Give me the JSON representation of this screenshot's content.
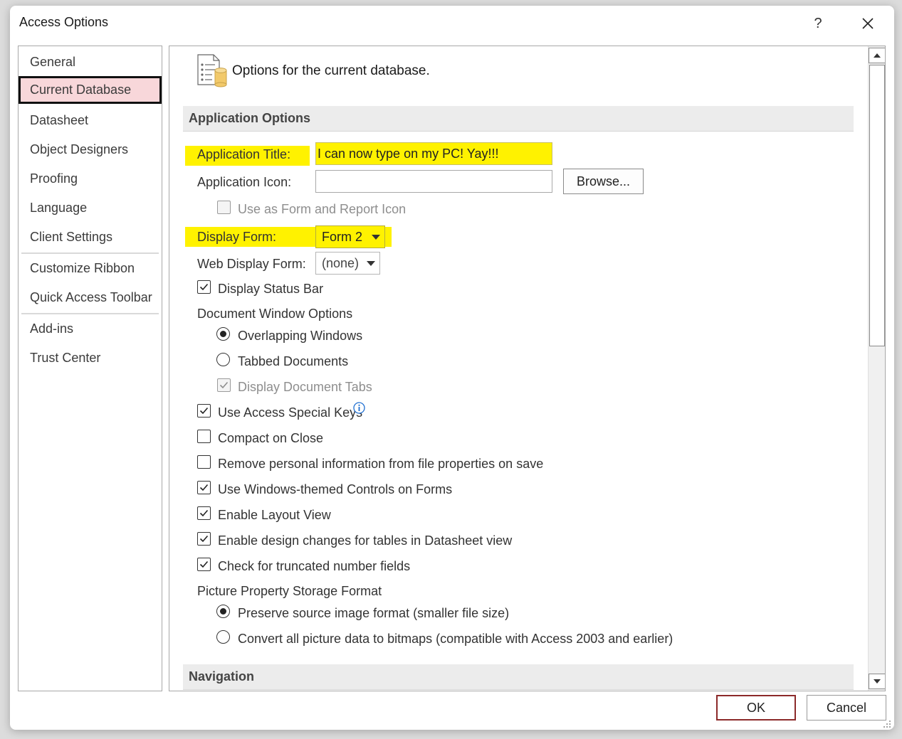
{
  "window": {
    "title": "Access Options",
    "help_label": "?"
  },
  "sidebar": {
    "items": [
      {
        "label": "General"
      },
      {
        "label": "Current Database"
      },
      {
        "label": "Datasheet"
      },
      {
        "label": "Object Designers"
      },
      {
        "label": "Proofing"
      },
      {
        "label": "Language"
      },
      {
        "label": "Client Settings"
      },
      {
        "label": "Customize Ribbon"
      },
      {
        "label": "Quick Access Toolbar"
      },
      {
        "label": "Add-ins"
      },
      {
        "label": "Trust Center"
      }
    ],
    "selected": "Current Database"
  },
  "main": {
    "header": "Options for the current database.",
    "sections": {
      "application_options": "Application Options",
      "navigation": "Navigation"
    },
    "app_title": {
      "label": "Application Title:",
      "value": "I can now type on my PC! Yay!!!"
    },
    "app_icon": {
      "label": "Application Icon:",
      "value": "",
      "browse_label": "Browse..."
    },
    "use_as_form_icon": {
      "label": "Use as Form and Report Icon",
      "checked": false,
      "enabled": false
    },
    "display_form": {
      "label": "Display Form:",
      "value": "Form 2"
    },
    "web_display_form": {
      "label": "Web Display Form:",
      "value": "(none)"
    },
    "display_status_bar": {
      "label": "Display Status Bar",
      "checked": true
    },
    "document_window_options": {
      "label": "Document Window Options",
      "overlapping": "Overlapping Windows",
      "tabbed": "Tabbed Documents",
      "selected": "Overlapping Windows",
      "display_document_tabs": {
        "label": "Display Document Tabs",
        "checked": true,
        "enabled": false
      }
    },
    "use_access_special_keys": {
      "label": "Use Access Special Keys",
      "checked": true
    },
    "compact_on_close": {
      "label": "Compact on Close",
      "checked": false
    },
    "remove_personal_info": {
      "label": "Remove personal information from file properties on save",
      "checked": false
    },
    "windows_themed_controls": {
      "label": "Use Windows-themed Controls on Forms",
      "checked": true
    },
    "enable_layout_view": {
      "label": "Enable Layout View",
      "checked": true
    },
    "enable_design_changes": {
      "label": "Enable design changes for tables in Datasheet view",
      "checked": true
    },
    "check_truncated": {
      "label": "Check for truncated number fields",
      "checked": true
    },
    "picture_storage": {
      "label": "Picture Property Storage Format",
      "preserve": "Preserve source image format (smaller file size)",
      "convert": "Convert all picture data to bitmaps (compatible with Access 2003 and earlier)",
      "selected": "Preserve source image format (smaller file size)"
    }
  },
  "footer": {
    "ok_label": "OK",
    "cancel_label": "Cancel"
  },
  "colors": {
    "highlight": "#fff200",
    "selected_nav_bg": "#f8d7da",
    "ok_border": "#8c2a2a"
  }
}
